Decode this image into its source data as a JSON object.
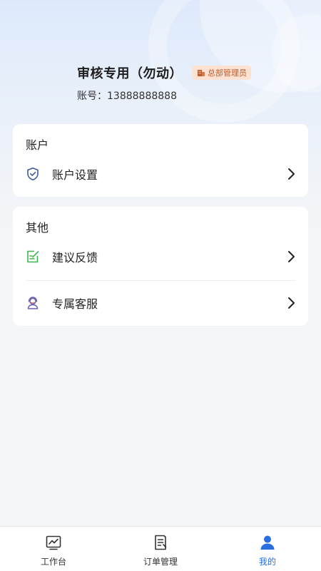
{
  "profile": {
    "name": "审核专用（勿动）",
    "role_badge": "总部管理员",
    "account_label": "账号：",
    "account_value": "13888888888"
  },
  "account_card": {
    "title": "账户",
    "items": [
      {
        "label": "账户设置",
        "icon": "shield-check-icon"
      }
    ]
  },
  "other_card": {
    "title": "其他",
    "items": [
      {
        "label": "建议反馈",
        "icon": "feedback-edit-icon"
      },
      {
        "label": "专属客服",
        "icon": "customer-service-icon"
      }
    ]
  },
  "bottom_nav": {
    "items": [
      {
        "label": "工作台",
        "icon": "chart-icon",
        "active": false
      },
      {
        "label": "订单管理",
        "icon": "order-doc-icon",
        "active": false
      },
      {
        "label": "我的",
        "icon": "user-icon",
        "active": true
      }
    ]
  },
  "colors": {
    "accent": "#2a6fe0",
    "badge_bg": "#fde2d2",
    "badge_text": "#c25a2a",
    "feedback_green": "#3fb54a"
  }
}
